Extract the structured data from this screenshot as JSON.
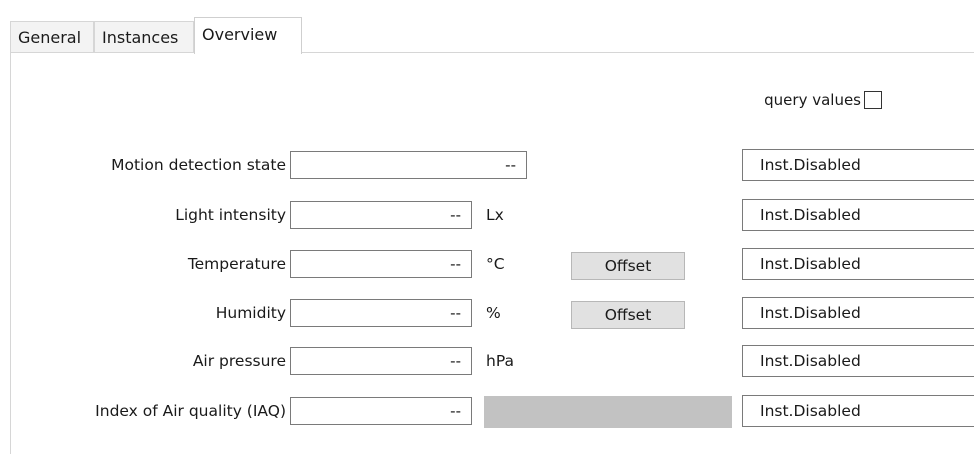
{
  "tabs": [
    {
      "label": "General"
    },
    {
      "label": "Instances"
    },
    {
      "label": "Overview",
      "active": true
    }
  ],
  "query": {
    "label": "query values",
    "checked": false
  },
  "rows": [
    {
      "label": "Motion detection state",
      "value": "--",
      "unit": "",
      "status": "Inst.Disabled"
    },
    {
      "label": "Light intensity",
      "value": "--",
      "unit": "Lx",
      "status": "Inst.Disabled"
    },
    {
      "label": "Temperature",
      "value": "--",
      "unit": "°C",
      "button": "Offset",
      "status": "Inst.Disabled"
    },
    {
      "label": "Humidity",
      "value": "--",
      "unit": "%",
      "button": "Offset",
      "status": "Inst.Disabled"
    },
    {
      "label": "Air pressure",
      "value": "--",
      "unit": "hPa",
      "status": "Inst.Disabled"
    },
    {
      "label": "Index of Air quality (IAQ)",
      "value": "--",
      "unit": "",
      "status": "Inst.Disabled"
    }
  ],
  "colors": {
    "iaq_bar": "#c2c2c2",
    "button_bg": "#e1e1e1"
  }
}
